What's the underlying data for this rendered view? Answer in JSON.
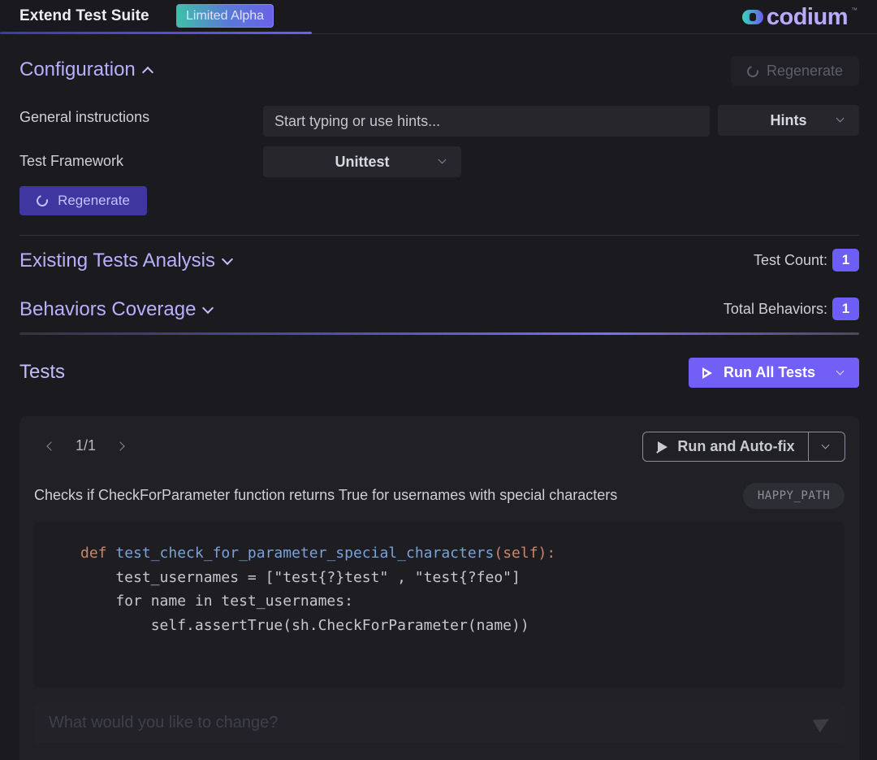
{
  "header": {
    "title": "Extend Test Suite",
    "badge": "Limited Alpha",
    "brand": "codium",
    "brand_tm": "™"
  },
  "configuration": {
    "title": "Configuration",
    "regenerate_top_label": "Regenerate",
    "general_instructions_label": "General instructions",
    "instructions_placeholder": "Start typing or use hints...",
    "hints_label": "Hints",
    "test_framework_label": "Test Framework",
    "test_framework_value": "Unittest",
    "regenerate_label": "Regenerate"
  },
  "existing_tests": {
    "title": "Existing Tests Analysis",
    "count_label": "Test Count:",
    "count_value": "1"
  },
  "behaviors": {
    "title": "Behaviors Coverage",
    "count_label": "Total Behaviors:",
    "count_value": "1"
  },
  "tests": {
    "title": "Tests",
    "run_all_label": "Run All Tests",
    "pager": "1/1",
    "run_autofix_label": "Run and Auto-fix",
    "description": "Checks if CheckForParameter function returns True for usernames with special characters",
    "tag": "HAPPY_PATH",
    "code": {
      "line1_kw": "def",
      "line1_fn": "test_check_for_parameter_special_characters",
      "line1_param": "(self):",
      "line2": "    test_usernames = [\"test{?}test\" , \"test{?feo\"]",
      "line3": "    for name in test_usernames:",
      "line4": "        self.assertTrue(sh.CheckForParameter(name))"
    },
    "change_placeholder": "What would you like to change?"
  },
  "colors": {
    "accent": "#7260f6",
    "badge": "#6d5ef5",
    "background": "#1b1b1f"
  }
}
